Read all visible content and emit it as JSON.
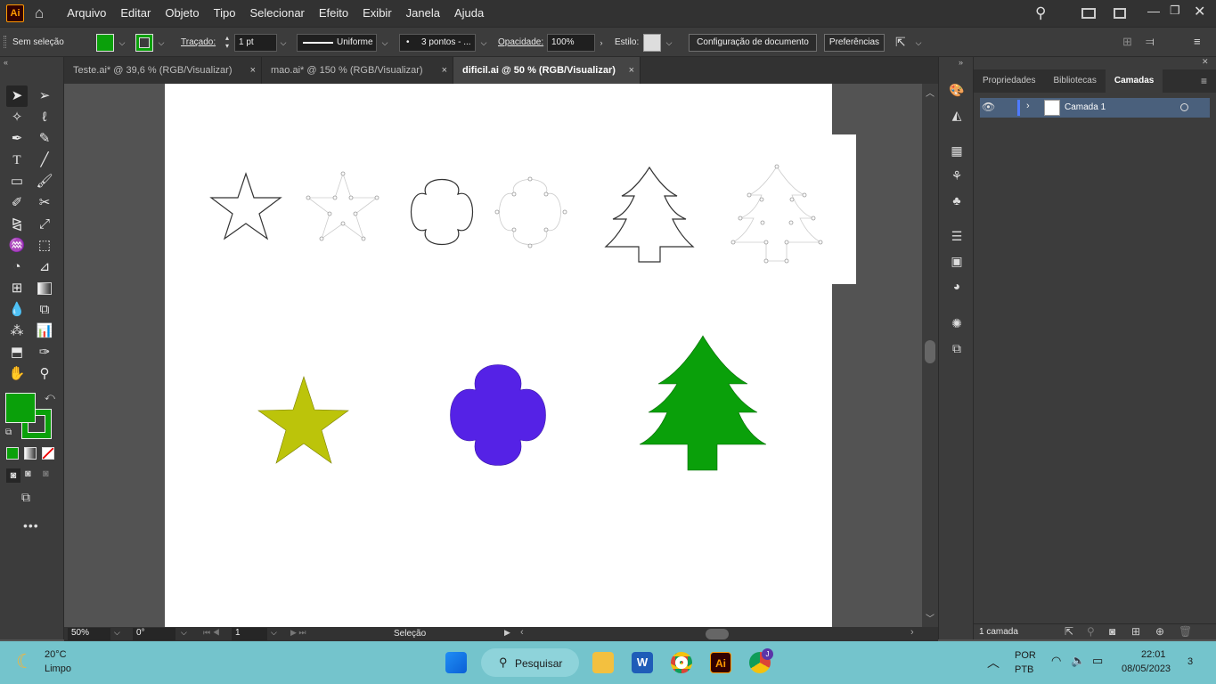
{
  "app": {
    "logo": "Ai"
  },
  "menu": [
    "Arquivo",
    "Editar",
    "Objeto",
    "Tipo",
    "Selecionar",
    "Efeito",
    "Exibir",
    "Janela",
    "Ajuda"
  ],
  "control": {
    "selection": "Sem seleção",
    "fill_color": "#0aa00a",
    "stroke_label": "Traçado:",
    "stroke_weight": "1 pt",
    "stroke_profile": "Uniforme",
    "brush": "3 pontos - ...",
    "opacity_label": "Opacidade:",
    "opacity": "100%",
    "style_label": "Estilo:",
    "doc_setup": "Configuração de documento",
    "preferences": "Preferências"
  },
  "tabs": [
    {
      "label": "Teste.ai* @ 39,6 % (RGB/Visualizar)",
      "active": false
    },
    {
      "label": "mao.ai* @ 150 % (RGB/Visualizar)",
      "active": false
    },
    {
      "label": "dificil.ai @ 50 % (RGB/Visualizar)",
      "active": true
    }
  ],
  "tab_close": "×",
  "shapes": {
    "star_color": "#bcc40a",
    "clover_color": "#5522e6",
    "tree_color": "#0aa00a"
  },
  "status": {
    "zoom": "50%",
    "rotation": "0°",
    "artboard": "1",
    "tool": "Seleção"
  },
  "panel": {
    "tabs": [
      "Propriedades",
      "Bibliotecas",
      "Camadas"
    ],
    "active_tab": "Camadas",
    "layer_name": "Camada 1",
    "footer": "1 camada"
  },
  "taskbar": {
    "temp": "20°C",
    "weather": "Limpo",
    "search": "Pesquisar",
    "lang1": "POR",
    "lang2": "PTB",
    "time": "22:01",
    "date": "08/05/2023",
    "notifications": "3",
    "chrome_badge": "J"
  }
}
